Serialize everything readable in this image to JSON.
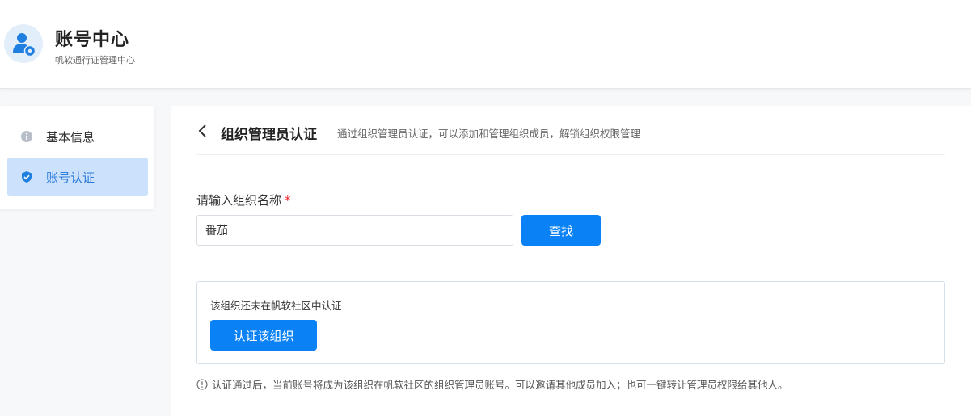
{
  "header": {
    "title": "账号中心",
    "subtitle": "帆软通行证管理中心",
    "logo_icon": "user-gear-icon"
  },
  "sidebar": {
    "items": [
      {
        "label": "基本信息",
        "icon": "info-circle-icon",
        "active": false
      },
      {
        "label": "账号认证",
        "icon": "shield-check-icon",
        "active": true
      }
    ]
  },
  "main": {
    "title": "组织管理员认证",
    "description": "通过组织管理员认证，可以添加和管理组织成员，解锁组织权限管理",
    "field_label": "请输入组织名称",
    "required_mark": "*",
    "input_value": "番茄",
    "search_label": "查找",
    "result_text": "该组织还未在帆软社区中认证",
    "certify_label": "认证该组织",
    "note": "认证通过后，当前账号将成为该组织在帆软社区的组织管理员账号。可以邀请其他成员加入；也可一键转让管理员权限给其他人。"
  },
  "colors": {
    "primary": "#0a82f5",
    "active_bg": "#cce1fb",
    "required": "#f5222d"
  }
}
